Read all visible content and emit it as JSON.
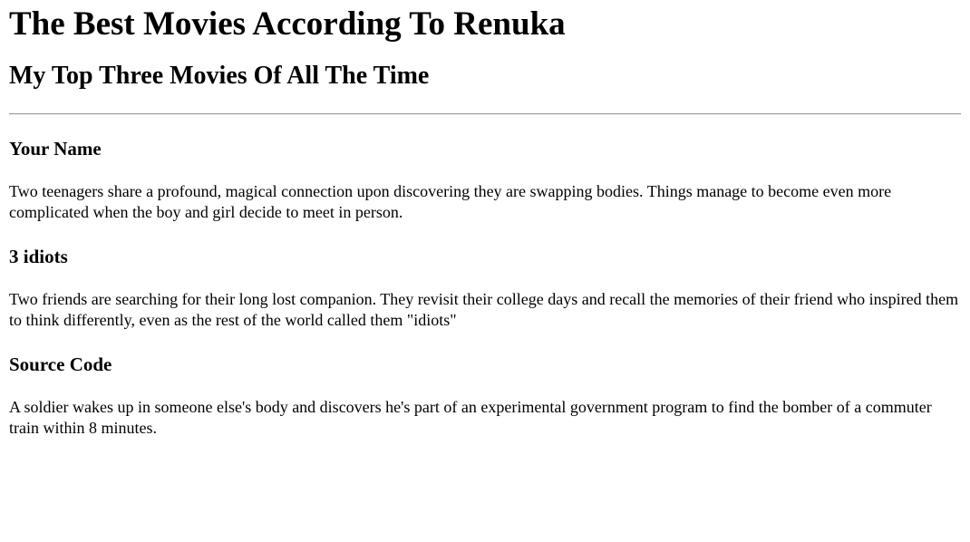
{
  "page": {
    "title": "The Best Movies According To Renuka",
    "subtitle": "My Top Three Movies Of All The Time"
  },
  "movies": [
    {
      "name": "Your Name",
      "description": "Two teenagers share a profound, magical connection upon discovering they are swapping bodies. Things manage to become even more complicated when the boy and girl decide to meet in person."
    },
    {
      "name": "3 idiots",
      "description": "Two friends are searching for their long lost companion. They revisit their college days and recall the memories of their friend who inspired them to think differently, even as the rest of the world called them \"idiots\""
    },
    {
      "name": "Source Code",
      "description": "A soldier wakes up in someone else's body and discovers he's part of an experimental government program to find the bomber of a commuter train within 8 minutes."
    }
  ]
}
